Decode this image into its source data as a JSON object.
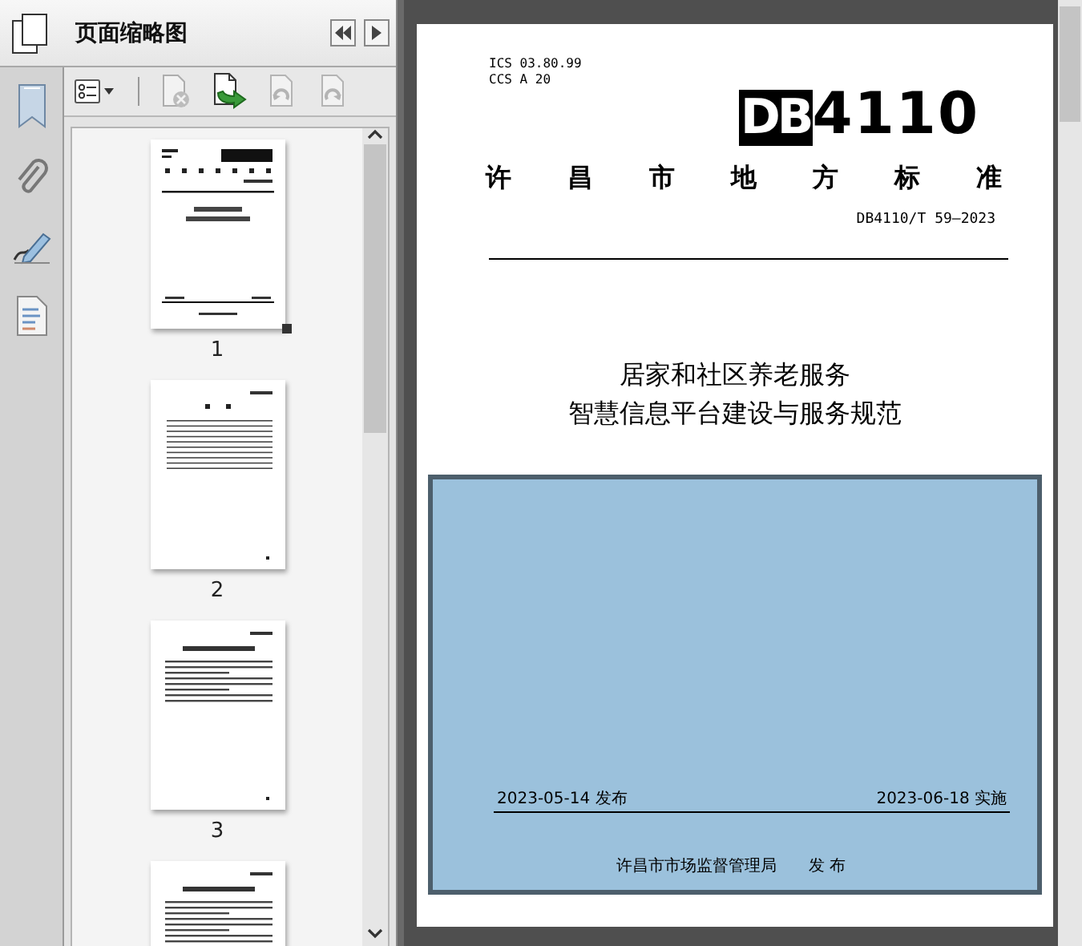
{
  "panel": {
    "title": "页面缩略图"
  },
  "toolbar": [
    {
      "kind": "options",
      "disabled": false
    },
    {
      "kind": "delete",
      "disabled": true
    },
    {
      "kind": "insert",
      "disabled": false
    },
    {
      "kind": "rotate-left",
      "disabled": true
    },
    {
      "kind": "rotate-right",
      "disabled": true
    }
  ],
  "thumbnails": [
    {
      "kind": "cover",
      "page_number": "1",
      "selected": true
    },
    {
      "kind": "contents",
      "page_number": "2",
      "selected": false
    },
    {
      "kind": "text",
      "page_number": "3",
      "selected": false
    },
    {
      "kind": "text",
      "selected": false
    }
  ],
  "document": {
    "ics": "ICS  03.80.99",
    "ccs": "CCS  A 20",
    "logo_prefix": "DB",
    "logo_number": "4110",
    "standard_type": "许昌市地方标准",
    "code": "DB4110/T 59—2023",
    "title_lines": [
      "居家和社区养老服务",
      "智慧信息平台建设与服务规范"
    ],
    "issue_date": "2023-05-14 发布",
    "effective_date": "2023-06-18 实施",
    "issuer": "许昌市市场监督管理局",
    "issuer_action": "发 布"
  }
}
